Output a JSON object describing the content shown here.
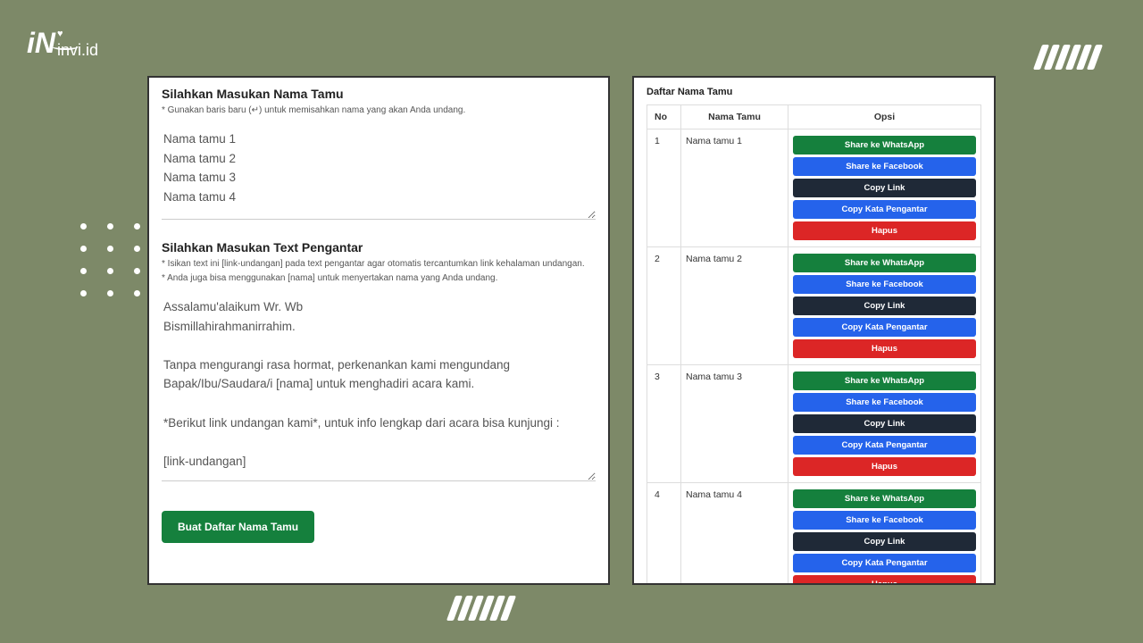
{
  "brand": {
    "name": "invi.id"
  },
  "left_panel": {
    "guests_title": "Silahkan Masukan Nama Tamu",
    "guests_note": "* Gunakan baris baru (↵) untuk memisahkan nama yang akan Anda undang.",
    "guests_value": "Nama tamu 1\nNama tamu 2\nNama tamu 3\nNama tamu 4",
    "intro_title": "Silahkan Masukan Text Pengantar",
    "intro_note1": "* Isikan text ini [link-undangan] pada text pengantar agar otomatis tercantumkan link kehalaman undangan.",
    "intro_note2": "* Anda juga bisa menggunakan [nama] untuk menyertakan nama yang Anda undang.",
    "intro_value": "Assalamu'alaikum Wr. Wb\nBismillahirahmanirrahim.\n\nTanpa mengurangi rasa hormat, perkenankan kami mengundang Bapak/Ibu/Saudara/i [nama] untuk menghadiri acara kami.\n\n*Berikut link undangan kami*, untuk info lengkap dari acara bisa kunjungi :\n\n[link-undangan]",
    "submit_label": "Buat Daftar Nama Tamu"
  },
  "right_panel": {
    "title": "Daftar Nama Tamu",
    "col_no": "No",
    "col_name": "Nama Tamu",
    "col_opsi": "Opsi",
    "btn_wa": "Share ke WhatsApp",
    "btn_fb": "Share ke Facebook",
    "btn_copy": "Copy Link",
    "btn_copytext": "Copy Kata Pengantar",
    "btn_del": "Hapus",
    "rows": [
      {
        "no": "1",
        "name": "Nama tamu 1"
      },
      {
        "no": "2",
        "name": "Nama tamu 2"
      },
      {
        "no": "3",
        "name": "Nama tamu 3"
      },
      {
        "no": "4",
        "name": "Nama tamu 4"
      }
    ]
  }
}
